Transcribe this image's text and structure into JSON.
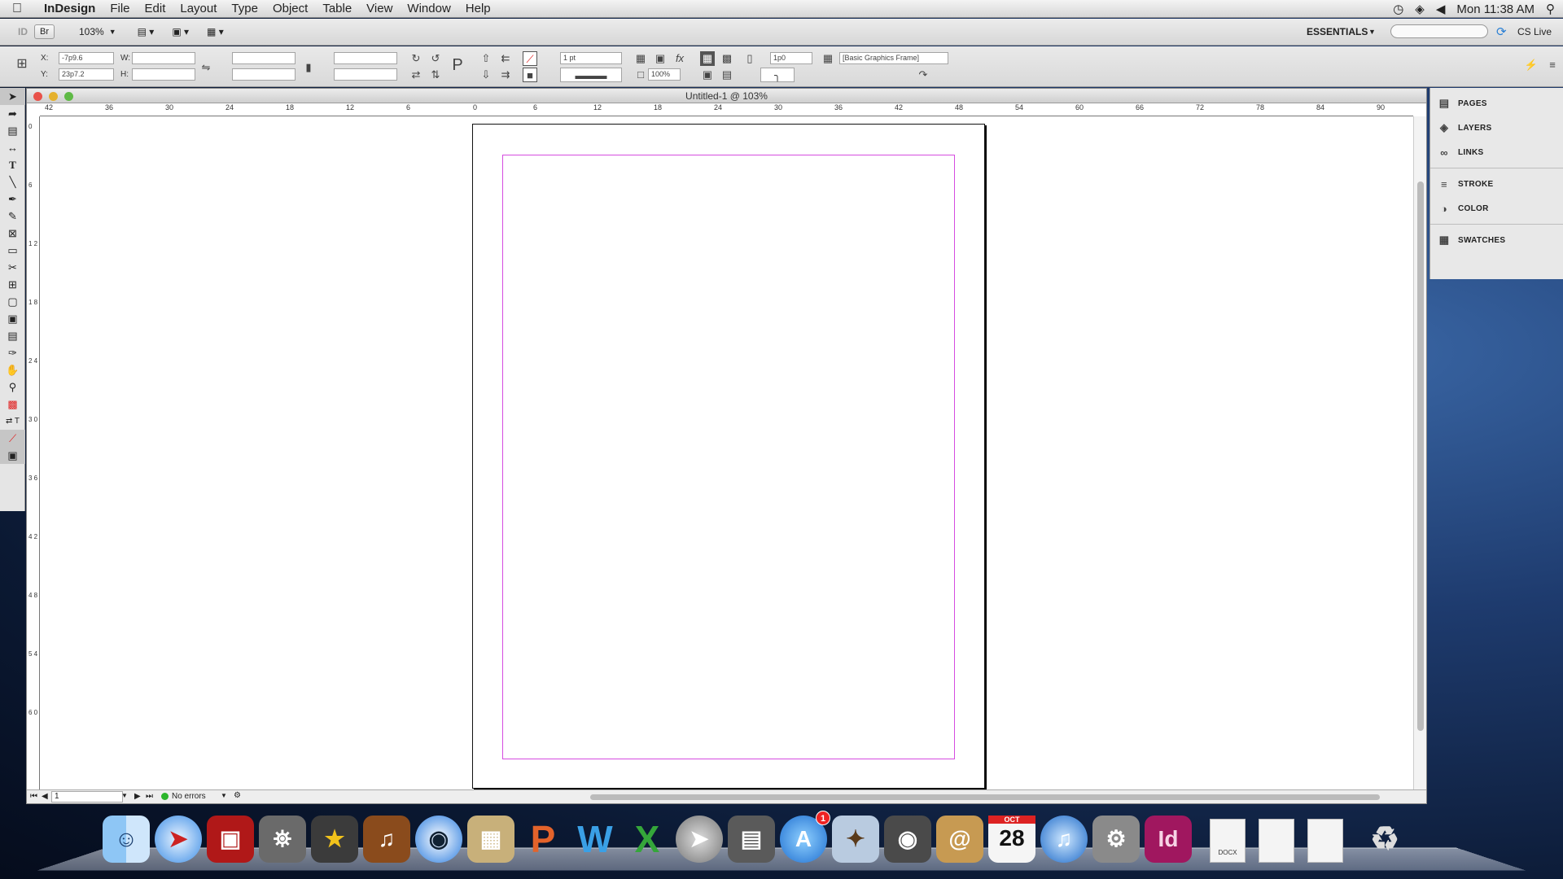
{
  "menubar": {
    "apple": "",
    "app_name": "InDesign",
    "items": [
      "File",
      "Edit",
      "Layout",
      "Type",
      "Object",
      "Table",
      "View",
      "Window",
      "Help"
    ],
    "clock": "Mon 11:38 AM"
  },
  "app_bar": {
    "id_logo": "ID",
    "bridge": "Br",
    "zoom": "103%",
    "workspace": "ESSENTIALS",
    "search_placeholder": "",
    "cs_live": "CS Live"
  },
  "control_panel": {
    "x_label": "X:",
    "x_value": "-7p9.6",
    "y_label": "Y:",
    "y_value": "23p7.2",
    "w_label": "W:",
    "h_label": "H:",
    "stroke_weight": "1 pt",
    "opacity": "100%",
    "offset": "1p0",
    "object_style": "[Basic Graphics Frame]"
  },
  "document": {
    "title": "Untitled-1 @ 103%",
    "ruler_h": [
      "42",
      "36",
      "30",
      "24",
      "18",
      "12",
      "6",
      "0",
      "6",
      "12",
      "18",
      "24",
      "30",
      "36",
      "42",
      "48",
      "54",
      "60",
      "66",
      "72",
      "78",
      "84",
      "90"
    ],
    "ruler_v": [
      "0",
      "6",
      "1 2",
      "1 8",
      "2 4",
      "3 0",
      "3 6",
      "4 2",
      "4 8",
      "5 4",
      "6 0"
    ],
    "page_number": "1",
    "preflight": "No errors",
    "colors": {
      "margin_guide": "#d54ce0",
      "preflight_ok": "#2bb52b"
    }
  },
  "panels": {
    "group1": [
      "PAGES",
      "LAYERS",
      "LINKS"
    ],
    "group2": [
      "STROKE",
      "COLOR"
    ],
    "group3": [
      "SWATCHES"
    ]
  },
  "dock": {
    "app_store_badge": "1",
    "calendar_month": "OCT",
    "calendar_day": "28",
    "indesign_label": "Id",
    "doc_label": "DOCX"
  }
}
